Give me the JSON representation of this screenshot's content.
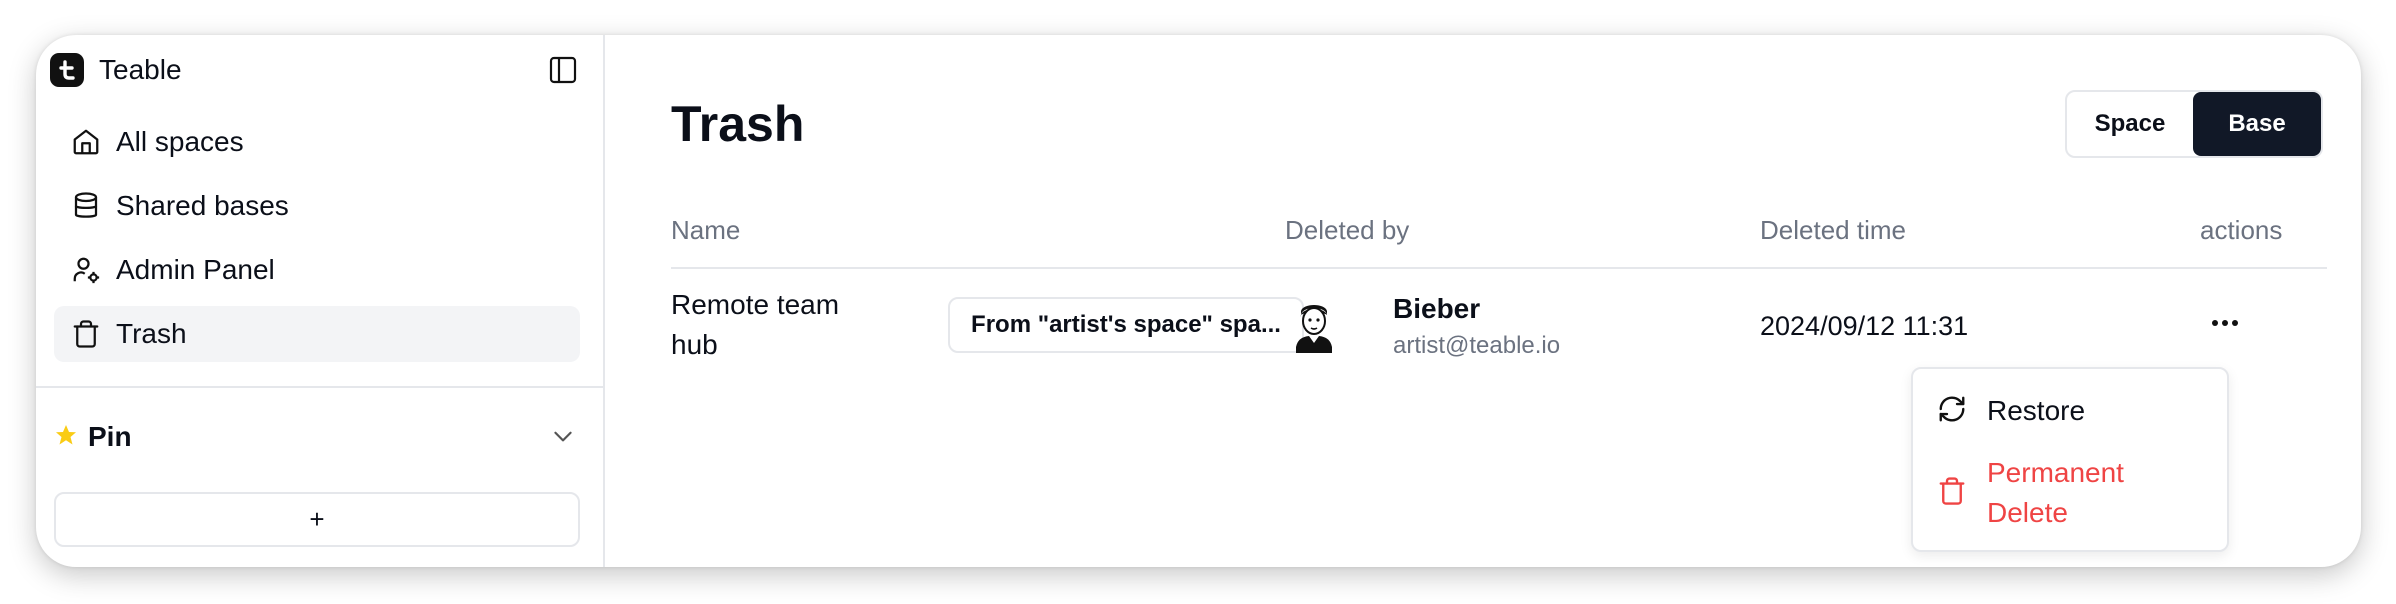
{
  "app": {
    "name": "Teable"
  },
  "sidebar": {
    "items": [
      {
        "label": "All spaces",
        "icon": "home-icon"
      },
      {
        "label": "Shared bases",
        "icon": "database-icon"
      },
      {
        "label": "Admin Panel",
        "icon": "user-cog-icon"
      },
      {
        "label": "Trash",
        "icon": "trash-icon",
        "active": true
      }
    ],
    "pin": {
      "label": "Pin",
      "icon": "star-icon"
    },
    "add_label": "+"
  },
  "main": {
    "title": "Trash",
    "toggle": {
      "options": [
        "Space",
        "Base"
      ],
      "selected": "Base"
    },
    "table": {
      "headers": {
        "name": "Name",
        "deleted_by": "Deleted by",
        "deleted_time": "Deleted time",
        "actions": "actions"
      },
      "rows": [
        {
          "name": "Remote team hub",
          "origin": "From \"artist's space\" spa...",
          "user": {
            "name": "Bieber",
            "email": "artist@teable.io"
          },
          "deleted_time": "2024/09/12 11:31"
        }
      ]
    },
    "actions_menu": {
      "items": [
        {
          "label": "Restore",
          "icon": "refresh-icon"
        },
        {
          "label": "Permanent Delete",
          "icon": "trash-icon",
          "destructive": true
        }
      ]
    }
  },
  "colors": {
    "accent_dark": "#111827",
    "destructive": "#ef4444",
    "pin_star": "#facc15",
    "muted_text": "#6b7280",
    "active_bg": "#f3f4f6"
  }
}
